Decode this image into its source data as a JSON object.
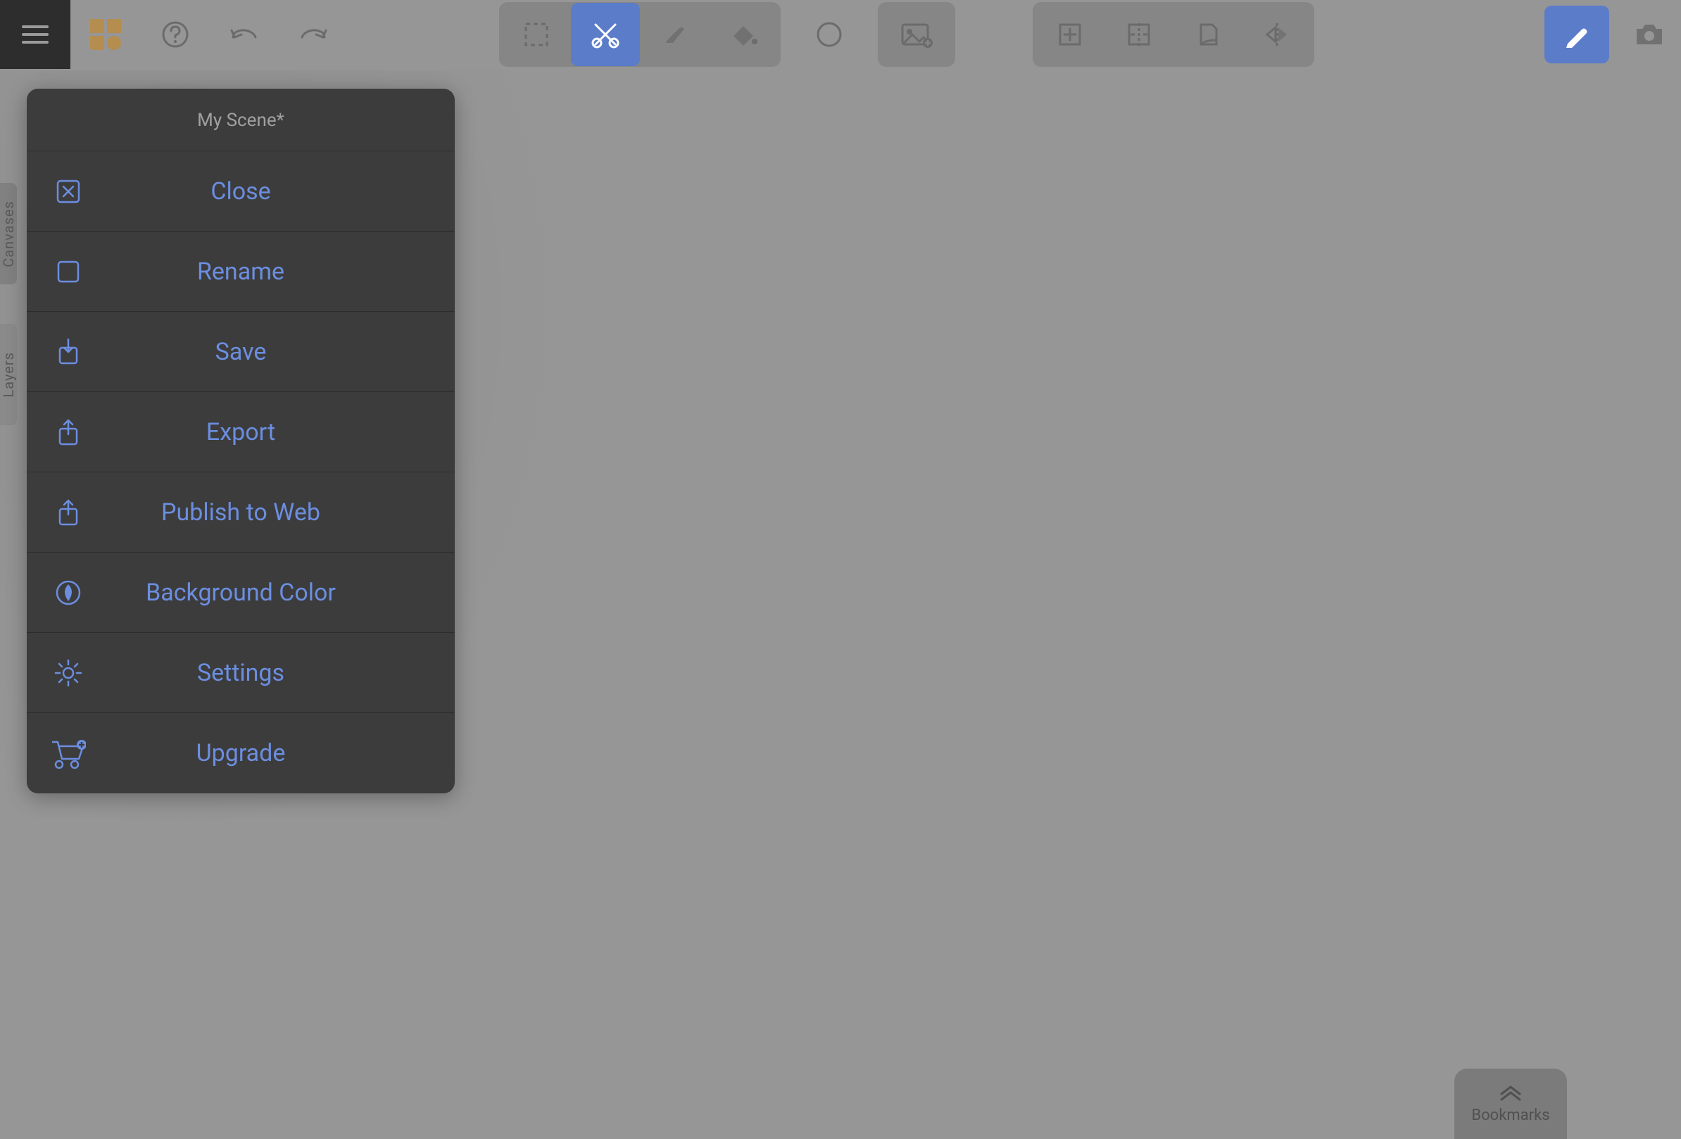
{
  "scene_title": "My Scene*",
  "menu": {
    "close": "Close",
    "rename": "Rename",
    "save": "Save",
    "export": "Export",
    "publish": "Publish to Web",
    "background": "Background Color",
    "settings": "Settings",
    "upgrade": "Upgrade"
  },
  "side": {
    "canvases": "Canvases",
    "layers": "Layers"
  },
  "bookmarks_label": "Bookmarks",
  "colors": {
    "accent": "#6c8ee0",
    "menu_bg": "#3c3c3c",
    "canvas_bg": "#969696",
    "active_tool": "#5b7cc9",
    "template_icon": "#b48d4f"
  },
  "toolbar": {
    "hamburger": "menu",
    "templates": "templates",
    "help": "help",
    "undo": "undo",
    "redo": "redo",
    "select": "select",
    "cut_tool": "cut",
    "eraser": "eraser",
    "bucket": "bucket",
    "circle": "circle-shape",
    "image": "insert-image",
    "add_panel": "add-panel",
    "split": "split",
    "page": "page",
    "mirror": "mirror",
    "pen": "pen",
    "camera": "camera"
  }
}
